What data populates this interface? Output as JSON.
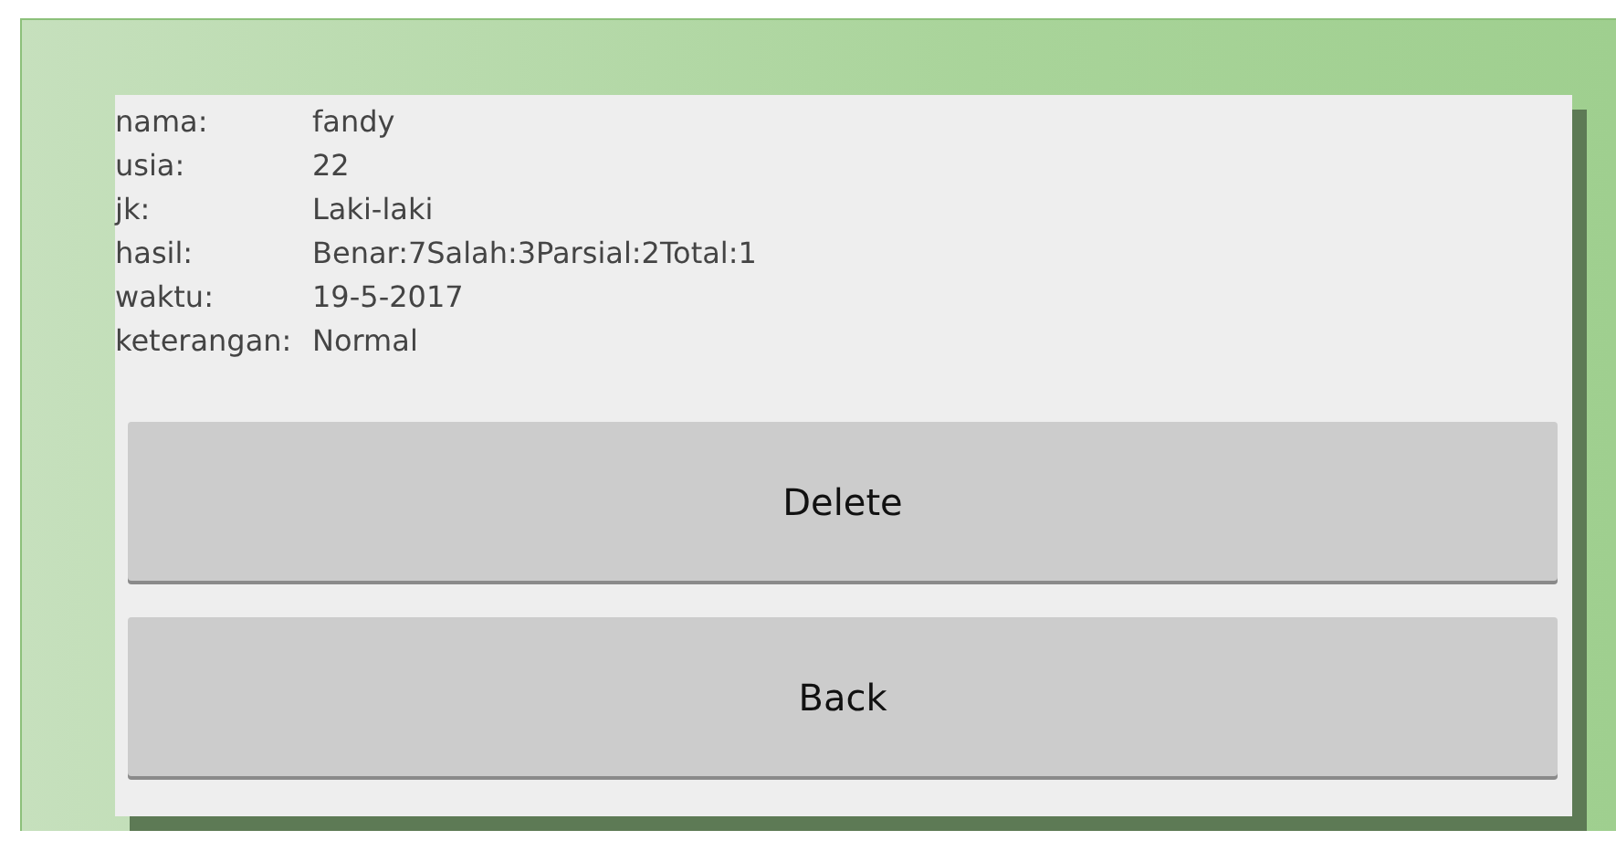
{
  "details": [
    {
      "label": "nama:",
      "value": "fandy"
    },
    {
      "label": "usia:",
      "value": "22"
    },
    {
      "label": "jk:",
      "value": "Laki-laki"
    },
    {
      "label": "hasil:",
      "value": "Benar:7Salah:3Parsial:2Total:1"
    },
    {
      "label": "waktu:",
      "value": "19-5-2017"
    },
    {
      "label": "keterangan:",
      "value": "Normal"
    }
  ],
  "buttons": [
    "Delete",
    "Back"
  ]
}
